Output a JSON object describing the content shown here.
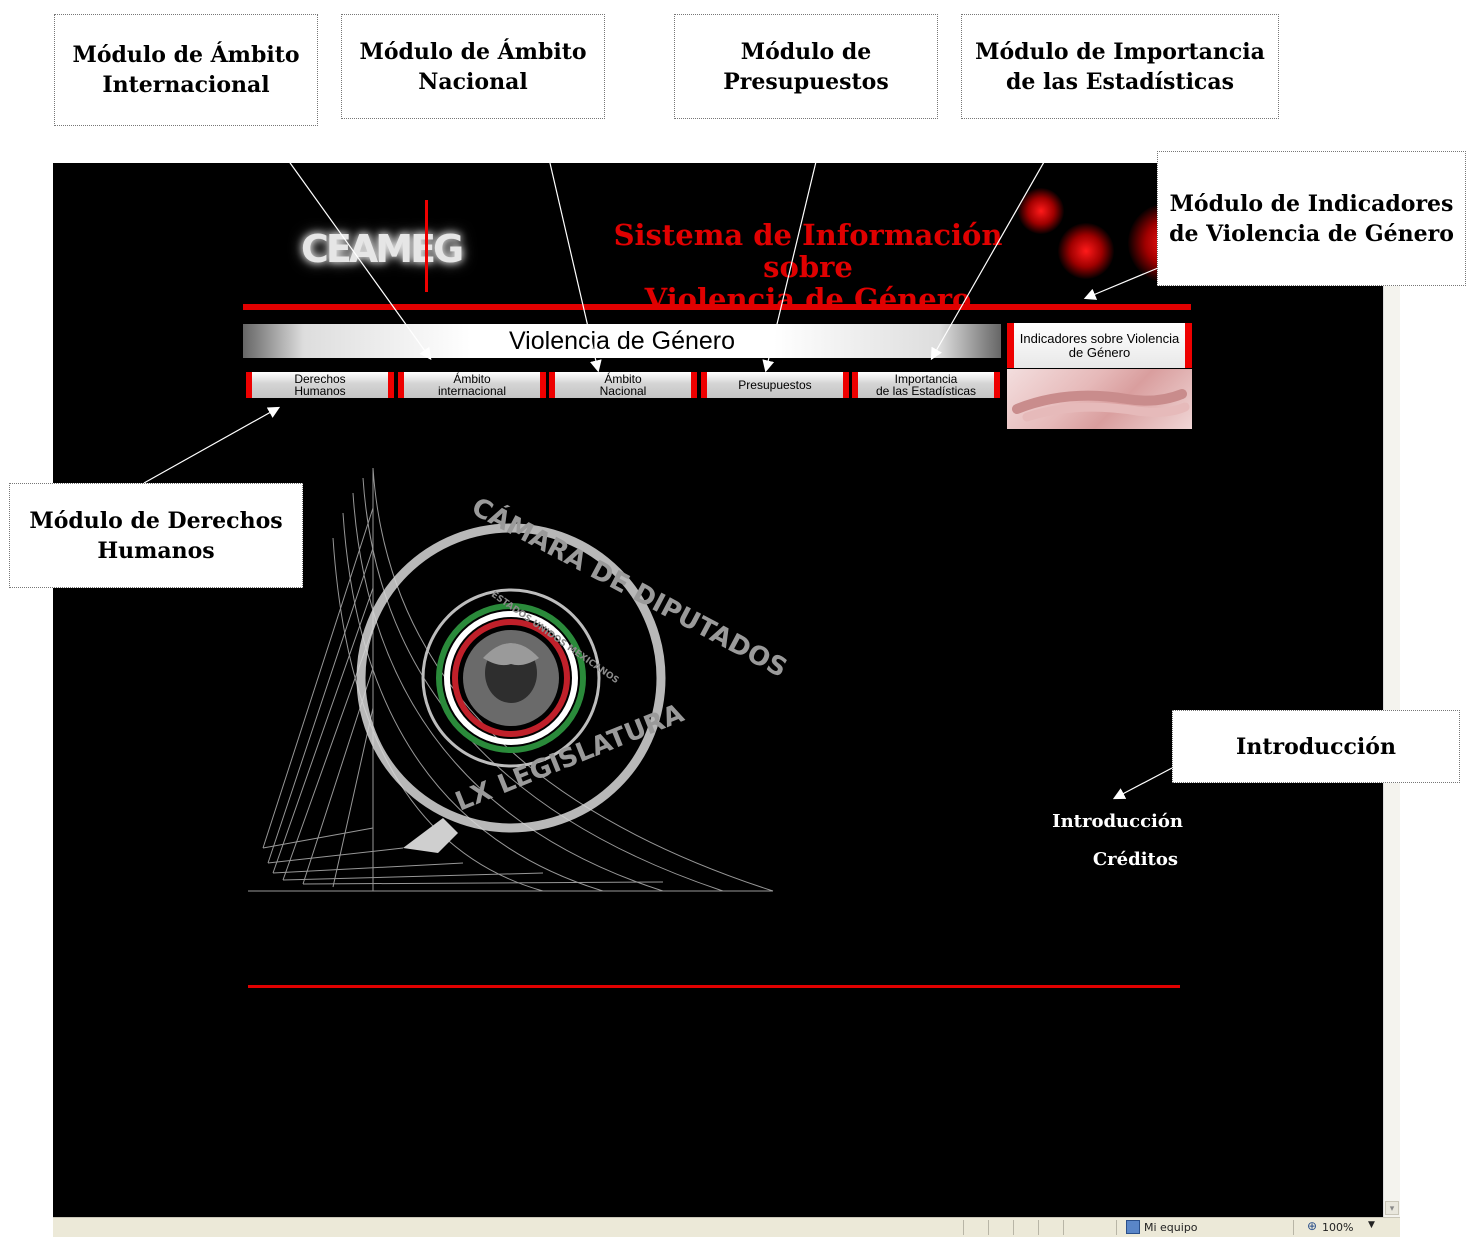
{
  "callouts": {
    "internacional": "Módulo de Ámbito Internacional",
    "nacional": "Módulo de Ámbito Nacional",
    "presupuestos": "Módulo de Presupuestos",
    "estadisticas": "Módulo de Importancia de las Estadísticas",
    "indicadores": "Módulo de Indicadores de Violencia de Género",
    "derechos": "Módulo de Derechos Humanos",
    "introduccion": "Introducción"
  },
  "site": {
    "logo_text": "CEAMEG",
    "title_line1": "Sistema de Información sobre",
    "title_line2": "Violencia de Género",
    "banner": "Violencia de Género",
    "indicators_button": "Indicadores sobre Violencia de Género"
  },
  "nav": [
    {
      "id": "derechos",
      "line1": "Derechos",
      "line2": "Humanos"
    },
    {
      "id": "internacional",
      "line1": "Ámbito",
      "line2": "internacional"
    },
    {
      "id": "nacional",
      "line1": "Ámbito",
      "line2": "Nacional"
    },
    {
      "id": "presupuestos",
      "line1": "Presupuestos",
      "line2": ""
    },
    {
      "id": "estadisticas",
      "line1": "Importancia",
      "line2": "de las Estadísticas"
    }
  ],
  "seal": {
    "outer_text": "CÁMARA DE DIPUTADOS",
    "inner_text": "ESTADOS UNIDOS MEXICANOS",
    "bottom_text": "LX LEGISLATURA"
  },
  "menu": {
    "intro": "Introducción",
    "credits": "Créditos"
  },
  "statusbar": {
    "zone": "Mi equipo",
    "zoom": "100%"
  },
  "colors": {
    "accent": "#e00000",
    "background": "#000000"
  }
}
